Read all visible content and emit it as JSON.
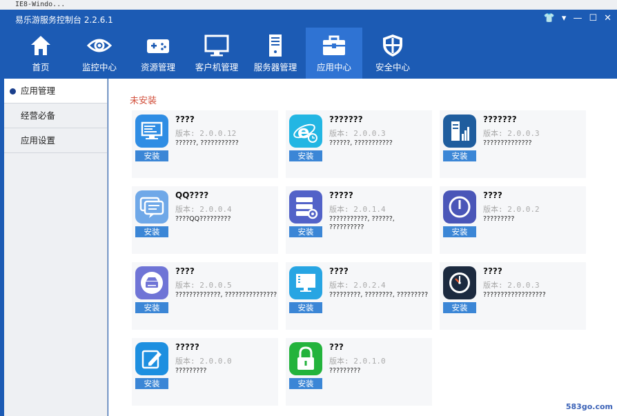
{
  "window_strip_text": "IE8-Windo...",
  "app_title": "易乐游服务控制台 2.2.6.1",
  "window_controls": [
    "👕",
    "▾",
    "—",
    "☐",
    "✕"
  ],
  "nav": [
    {
      "label": "首页",
      "icon": "home-icon"
    },
    {
      "label": "监控中心",
      "icon": "eye-icon"
    },
    {
      "label": "资源管理",
      "icon": "gamepad-icon"
    },
    {
      "label": "客户机管理",
      "icon": "monitor-icon"
    },
    {
      "label": "服务器管理",
      "icon": "server-icon"
    },
    {
      "label": "应用中心",
      "icon": "toolbox-icon",
      "active": true
    },
    {
      "label": "安全中心",
      "icon": "shield-icon"
    }
  ],
  "sidebar": {
    "items": [
      {
        "label": "应用管理",
        "active": true
      },
      {
        "label": "经营必备"
      },
      {
        "label": "应用设置"
      }
    ]
  },
  "main": {
    "section_title": "未安装",
    "install_label": "安装",
    "apps": [
      {
        "name": "????",
        "version": "版本: 2.0.0.12",
        "desc": "??????, ???????????",
        "icon": "desktop-icon",
        "color": "#2f8de4"
      },
      {
        "name": "???????",
        "version": "版本: 2.0.0.3",
        "desc": "??????, ???????????",
        "icon": "ie-browser-icon",
        "color": "#23b6e3"
      },
      {
        "name": "???????",
        "version": "版本: 2.0.0.3",
        "desc": "??????????????",
        "icon": "server-chart-icon",
        "color": "#1f5d9e"
      },
      {
        "name": "QQ????",
        "version": "版本: 2.0.0.4",
        "desc": "????QQ?????????",
        "icon": "chat-icon",
        "color": "#6fa8e8"
      },
      {
        "name": "?????",
        "version": "版本: 2.0.1.4",
        "desc": "???????????, ??????, ??????????",
        "icon": "server-settings-icon",
        "color": "#5262c8"
      },
      {
        "name": "????",
        "version": "版本: 2.0.0.2",
        "desc": "?????????",
        "icon": "power-icon",
        "color": "#4a56b8"
      },
      {
        "name": "????",
        "version": "版本: 2.0.0.5",
        "desc": "?????????????, ???????????????",
        "icon": "disk-icon",
        "color": "#6f74d6"
      },
      {
        "name": "????",
        "version": "版本: 2.0.2.4",
        "desc": "?????????, ????????, ?????????",
        "icon": "screen-icon",
        "color": "#27a5e3"
      },
      {
        "name": "????",
        "version": "版本: 2.0.0.3",
        "desc": "??????????????????",
        "icon": "clock-icon",
        "color": "#1c2a3f"
      },
      {
        "name": "?????",
        "version": "版本: 2.0.0.0",
        "desc": "?????????",
        "icon": "edit-icon",
        "color": "#1d8fe0"
      },
      {
        "name": "???",
        "version": "版本: 2.0.1.0",
        "desc": "?????????",
        "icon": "lock-icon",
        "color": "#23b33c"
      }
    ]
  },
  "watermark": "583go.com"
}
